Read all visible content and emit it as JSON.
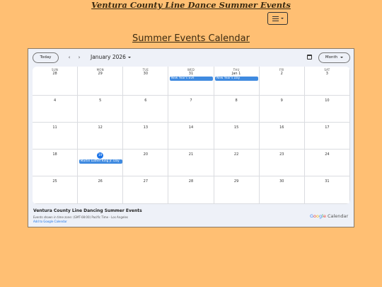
{
  "site": {
    "title": "Ventura County Line Dance Summer Events"
  },
  "page": {
    "heading": "Summer Events Calendar"
  },
  "calendar": {
    "today_label": "Today",
    "prev_label": "‹",
    "next_label": "›",
    "month_label": "January 2026",
    "view_label": "Month",
    "weekdays": [
      "SUN",
      "MON",
      "TUE",
      "WED",
      "THU",
      "FRI",
      "SAT"
    ],
    "weeks": [
      [
        "28",
        "29",
        "30",
        "31",
        "Jan 1",
        "2",
        "3"
      ],
      [
        "4",
        "5",
        "6",
        "7",
        "8",
        "9",
        "10"
      ],
      [
        "11",
        "12",
        "13",
        "14",
        "15",
        "16",
        "17"
      ],
      [
        "18",
        "19",
        "20",
        "21",
        "22",
        "23",
        "24"
      ],
      [
        "25",
        "26",
        "27",
        "28",
        "29",
        "30",
        "31"
      ]
    ],
    "today": {
      "week": 3,
      "day": 1
    },
    "events": [
      {
        "week": 0,
        "day": 3,
        "title": "New Year's Eve"
      },
      {
        "week": 0,
        "day": 4,
        "title": "New Year's Day"
      },
      {
        "week": 3,
        "day": 1,
        "title": "Martin Luther King Jr. Day"
      }
    ],
    "event_color": "#3f8ae0",
    "today_color": "#1a73e8"
  },
  "footer": {
    "title": "Ventura County Line Dancing Summer Events",
    "timezone": "Events shown in time zone: (GMT-08:00) Pacific Time - Los Angeles",
    "add_link": "Add to Google Calendar",
    "logo_letters": [
      "G",
      "o",
      "o",
      "g",
      "l",
      "e"
    ],
    "logo_word": "Calendar"
  },
  "colors": {
    "page_background": "#ffbf73",
    "calendar_background": "#eef1f8"
  }
}
